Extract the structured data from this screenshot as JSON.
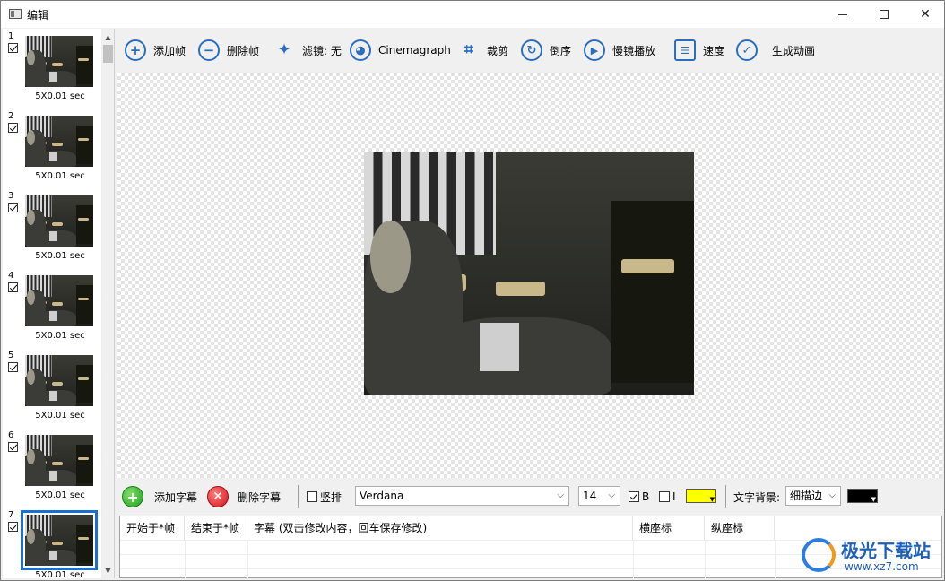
{
  "window": {
    "title": "编辑"
  },
  "frames": [
    {
      "num": "1",
      "label": "5X0.01 sec"
    },
    {
      "num": "2",
      "label": "5X0.01 sec"
    },
    {
      "num": "3",
      "label": "5X0.01 sec"
    },
    {
      "num": "4",
      "label": "5X0.01 sec"
    },
    {
      "num": "5",
      "label": "5X0.01 sec"
    },
    {
      "num": "6",
      "label": "5X0.01 sec"
    },
    {
      "num": "7",
      "label": "5X0.01 sec",
      "selected": true
    }
  ],
  "toolbar": {
    "add_frame": "添加帧",
    "delete_frame": "删除帧",
    "filter": "滤镜: 无",
    "cinemagraph": "Cinemagraph",
    "crop": "裁剪",
    "reverse": "倒序",
    "slow_motion": "慢镜播放",
    "speed": "速度",
    "generate": "生成动画"
  },
  "subtitle_bar": {
    "add_subtitle": "添加字幕",
    "delete_subtitle": "删除字幕",
    "vertical_label": "竖排",
    "font": "Verdana",
    "size": "14",
    "bold_label": "B",
    "italic_label": "I",
    "text_color": "#ffff00",
    "bg_label": "文字背景:",
    "bg_style": "细描边",
    "bg_color": "#000000"
  },
  "table": {
    "columns": [
      "开始于*帧",
      "结束于*帧",
      "字幕 (双击修改内容，回车保存修改)",
      "横座标",
      "纵座标"
    ]
  },
  "watermark": {
    "brand": "极光下载站",
    "url": "www.xz7.com"
  }
}
